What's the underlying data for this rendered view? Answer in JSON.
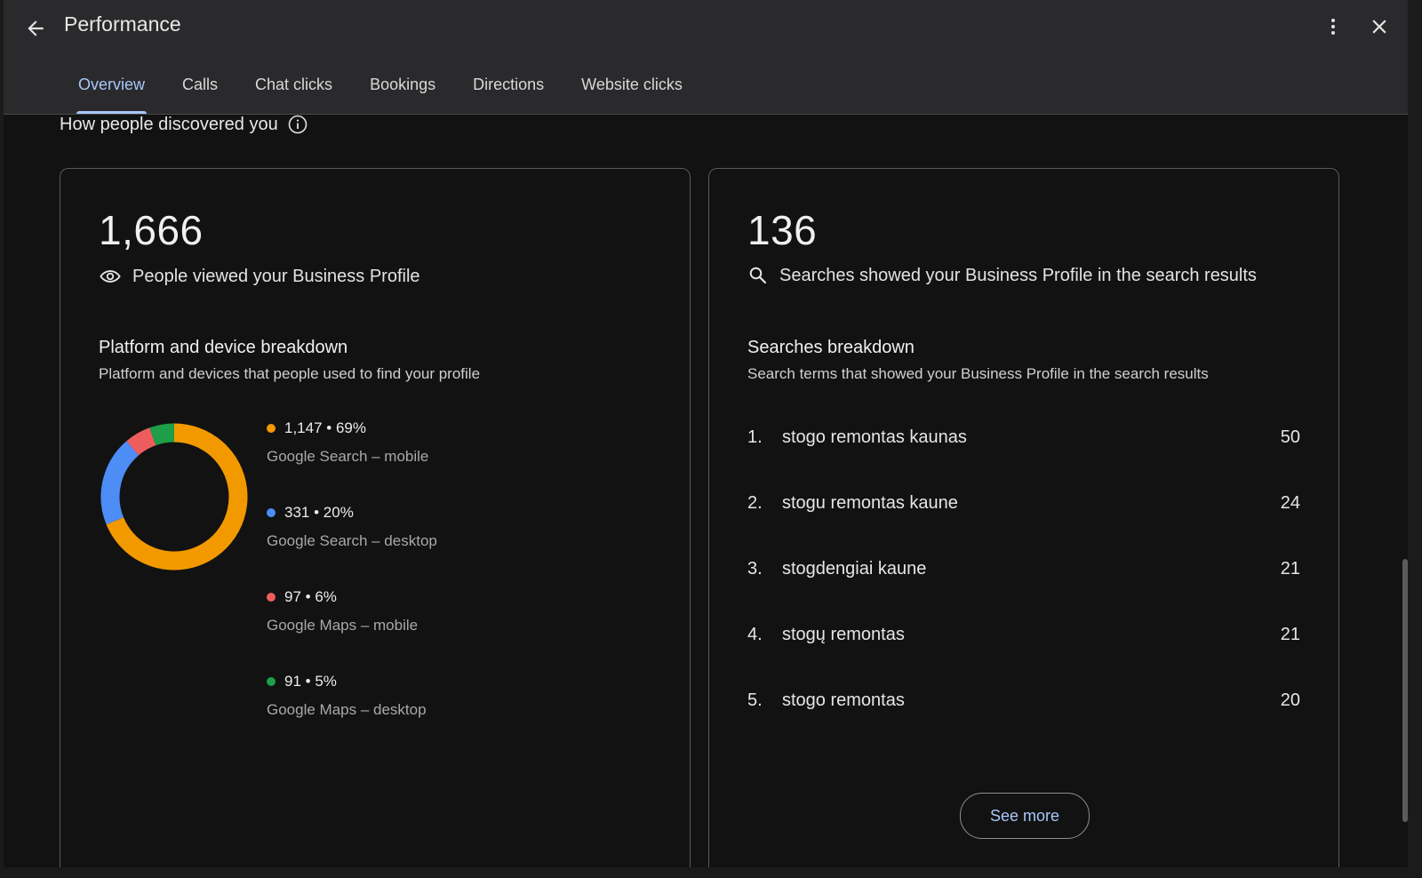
{
  "header": {
    "title": "Performance",
    "tabs": [
      {
        "label": "Overview",
        "active": true
      },
      {
        "label": "Calls",
        "active": false
      },
      {
        "label": "Chat clicks",
        "active": false
      },
      {
        "label": "Bookings",
        "active": false
      },
      {
        "label": "Directions",
        "active": false
      },
      {
        "label": "Website clicks",
        "active": false
      }
    ]
  },
  "section": {
    "title": "How people discovered you"
  },
  "views_card": {
    "total": "1,666",
    "label": "People viewed your Business Profile",
    "breakdown_title": "Platform and device breakdown",
    "breakdown_desc": "Platform and devices that people used to find your profile",
    "items": [
      {
        "value": "1,147",
        "percent": "69%",
        "label": "Google Search – mobile",
        "color": "#f29900"
      },
      {
        "value": "331",
        "percent": "20%",
        "label": "Google Search – desktop",
        "color": "#4c8df6"
      },
      {
        "value": "97",
        "percent": "6%",
        "label": "Google Maps – mobile",
        "color": "#ee5d5d"
      },
      {
        "value": "91",
        "percent": "5%",
        "label": "Google Maps – desktop",
        "color": "#1e9e48"
      }
    ]
  },
  "searches_card": {
    "total": "136",
    "label": "Searches showed your Business Profile in the search results",
    "breakdown_title": "Searches breakdown",
    "breakdown_desc": "Search terms that showed your Business Profile in the search results",
    "items": [
      {
        "index": "1.",
        "term": "stogo remontas kaunas",
        "count": "50"
      },
      {
        "index": "2.",
        "term": "stogu remontas kaune",
        "count": "24"
      },
      {
        "index": "3.",
        "term": "stogdengiai kaune",
        "count": "21"
      },
      {
        "index": "4.",
        "term": "stogų remontas",
        "count": "21"
      },
      {
        "index": "5.",
        "term": "stogo remontas",
        "count": "20"
      }
    ],
    "see_more_label": "See more"
  },
  "chart_data": {
    "type": "pie",
    "categories": [
      "Google Search – mobile",
      "Google Search – desktop",
      "Google Maps – mobile",
      "Google Maps – desktop"
    ],
    "values": [
      1147,
      331,
      97,
      91
    ],
    "colors": [
      "#f29900",
      "#4c8df6",
      "#ee5d5d",
      "#1e9e48"
    ]
  }
}
